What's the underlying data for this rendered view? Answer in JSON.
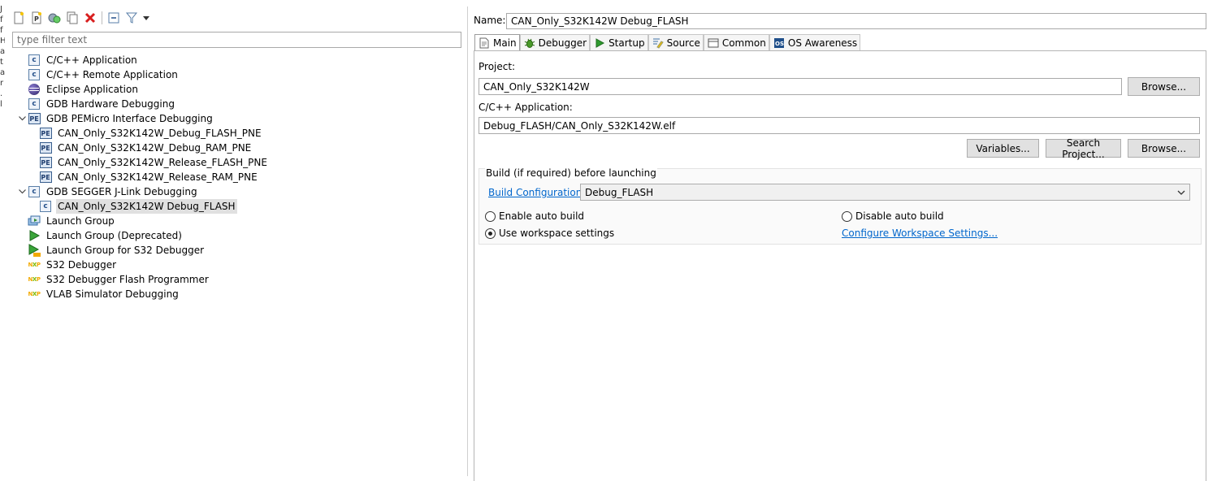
{
  "edge_fragment": [
    "J",
    "f",
    "f",
    "H",
    "a",
    "t",
    "a",
    "r",
    ".",
    "l"
  ],
  "filter": {
    "placeholder": "type filter text"
  },
  "tree": [
    {
      "label": "C/C++ Application",
      "icon": "c-icon",
      "level": 0
    },
    {
      "label": "C/C++ Remote Application",
      "icon": "c-icon",
      "level": 0
    },
    {
      "label": "Eclipse Application",
      "icon": "eclipse-icon",
      "level": 0
    },
    {
      "label": "GDB Hardware Debugging",
      "icon": "c-icon",
      "level": 0
    },
    {
      "label": "GDB PEMicro Interface Debugging",
      "icon": "pemicro-icon",
      "level": 0,
      "expanded": true
    },
    {
      "label": "CAN_Only_S32K142W_Debug_FLASH_PNE",
      "icon": "pemicro-icon",
      "level": 1
    },
    {
      "label": "CAN_Only_S32K142W_Debug_RAM_PNE",
      "icon": "pemicro-icon",
      "level": 1
    },
    {
      "label": "CAN_Only_S32K142W_Release_FLASH_PNE",
      "icon": "pemicro-icon",
      "level": 1
    },
    {
      "label": "CAN_Only_S32K142W_Release_RAM_PNE",
      "icon": "pemicro-icon",
      "level": 1
    },
    {
      "label": "GDB SEGGER J-Link Debugging",
      "icon": "c-icon",
      "level": 0,
      "expanded": true
    },
    {
      "label": "CAN_Only_S32K142W Debug_FLASH",
      "icon": "c-icon",
      "level": 1,
      "selected": true
    },
    {
      "label": "Launch Group",
      "icon": "launch-group-icon",
      "level": 0
    },
    {
      "label": "Launch Group (Deprecated)",
      "icon": "launch-deprecated-icon",
      "level": 0
    },
    {
      "label": "Launch Group for S32 Debugger",
      "icon": "launch-s32-icon",
      "level": 0
    },
    {
      "label": "S32 Debugger",
      "icon": "nxp-icon",
      "level": 0
    },
    {
      "label": "S32 Debugger Flash Programmer",
      "icon": "nxp-icon",
      "level": 0
    },
    {
      "label": "VLAB Simulator Debugging",
      "icon": "nxp-icon",
      "level": 0
    }
  ],
  "config": {
    "name_label": "Name:",
    "name_value": "CAN_Only_S32K142W Debug_FLASH",
    "tabs": [
      {
        "label": "Main",
        "icon": "main-icon",
        "active": true
      },
      {
        "label": "Debugger",
        "icon": "debugger-bug-icon"
      },
      {
        "label": "Startup",
        "icon": "startup-play-icon"
      },
      {
        "label": "Source",
        "icon": "source-icon"
      },
      {
        "label": "Common",
        "icon": "common-icon"
      },
      {
        "label": "OS Awareness",
        "icon": "os-awareness-icon"
      }
    ],
    "project_label": "Project:",
    "project_value": "CAN_Only_S32K142W",
    "browse_label": "Browse...",
    "app_label": "C/C++ Application:",
    "app_value": "Debug_FLASH/CAN_Only_S32K142W.elf",
    "variables_label": "Variables...",
    "search_project_label": "Search Project...",
    "build_group_label": "Build (if required) before launching",
    "build_config_label": "Build Configuration:",
    "build_config_value": "Debug_FLASH",
    "enable_auto_build": "Enable auto build",
    "disable_auto_build": "Disable auto build",
    "use_workspace_settings": "Use workspace settings",
    "configure_workspace_settings": "Configure Workspace Settings...",
    "selected_radio": "use_workspace_settings"
  }
}
